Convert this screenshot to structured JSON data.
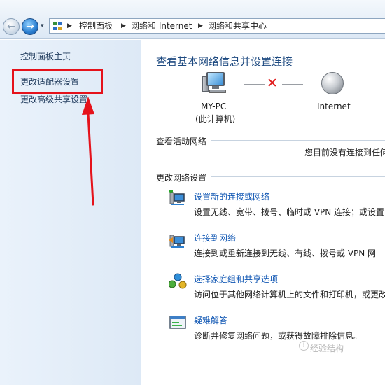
{
  "breadcrumb": {
    "items": [
      "控制面板",
      "网络和 Internet",
      "网络和共享中心"
    ]
  },
  "left_pane": {
    "links": [
      "控制面板主页",
      "更改适配器设置",
      "更改高级共享设置"
    ]
  },
  "main": {
    "heading": "查看基本网络信息并设置连接",
    "map": {
      "pc_name": "MY-PC",
      "pc_subtitle": "(此计算机)",
      "internet_label": "Internet"
    },
    "active_network": {
      "title": "查看活动网络",
      "status": "您目前没有连接到任何"
    },
    "change_settings": {
      "title": "更改网络设置",
      "tasks": [
        {
          "label": "设置新的连接或网络",
          "desc": "设置无线、宽带、拨号、临时或 VPN 连接；或设置",
          "icon": "new-connection-icon"
        },
        {
          "label": "连接到网络",
          "desc": "连接到或重新连接到无线、有线、拨号或 VPN 网",
          "icon": "connect-network-icon"
        },
        {
          "label": "选择家庭组和共享选项",
          "desc": "访问位于其他网络计算机上的文件和打印机，或更改",
          "icon": "homegroup-icon"
        },
        {
          "label": "疑难解答",
          "desc": "诊断并修复网络问题，或获得故障排除信息。",
          "icon": "troubleshoot-icon"
        }
      ]
    }
  },
  "annotation": {
    "highlight_color": "#e5121b"
  },
  "watermark": {
    "text": "经验结构"
  }
}
